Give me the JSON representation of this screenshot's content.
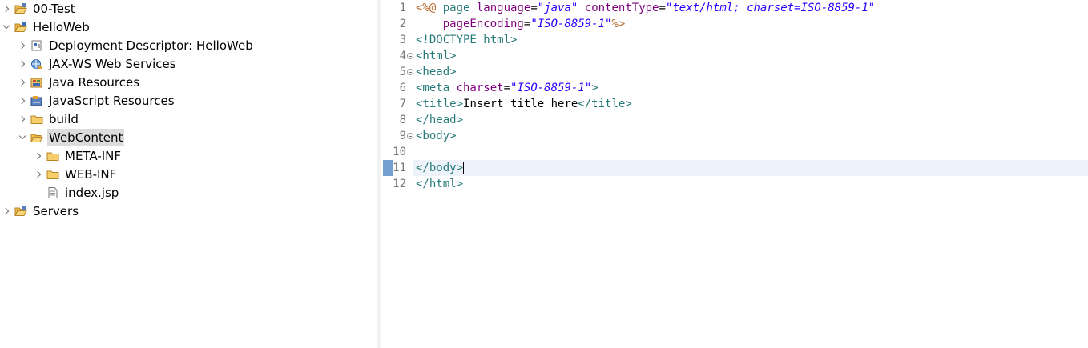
{
  "explorer": {
    "items": [
      {
        "label": "00-Test",
        "icon": "project-folder-icon",
        "expander": "right"
      },
      {
        "label": "HelloWeb",
        "icon": "web-project-icon",
        "expander": "down"
      },
      {
        "label": "Deployment Descriptor: HelloWeb",
        "icon": "deployment-descriptor-icon",
        "expander": "right"
      },
      {
        "label": "JAX-WS Web Services",
        "icon": "web-services-icon",
        "expander": "right"
      },
      {
        "label": "Java Resources",
        "icon": "java-resources-icon",
        "expander": "right"
      },
      {
        "label": "JavaScript Resources",
        "icon": "javascript-resources-icon",
        "expander": "right"
      },
      {
        "label": "build",
        "icon": "folder-icon",
        "expander": "right"
      },
      {
        "label": "WebContent",
        "icon": "open-folder-icon",
        "expander": "down",
        "selected": true
      },
      {
        "label": "META-INF",
        "icon": "folder-icon",
        "expander": "right"
      },
      {
        "label": "WEB-INF",
        "icon": "folder-icon",
        "expander": "right"
      },
      {
        "label": "index.jsp",
        "icon": "jsp-file-icon",
        "expander": "none"
      },
      {
        "label": "Servers",
        "icon": "project-folder-icon",
        "expander": "right"
      }
    ]
  },
  "editor": {
    "line_numbers": [
      "1",
      "2",
      "3",
      "4",
      "5",
      "6",
      "7",
      "8",
      "9",
      "10",
      "11",
      "12"
    ],
    "lines": [
      [
        {
          "t": "<%@",
          "c": "jsp"
        },
        {
          "t": " page ",
          "c": "tag"
        },
        {
          "t": "language",
          "c": "attr"
        },
        {
          "t": "=",
          "c": "plain"
        },
        {
          "t": "\"java\"",
          "c": "val"
        },
        {
          "t": " ",
          "c": "plain"
        },
        {
          "t": "contentType",
          "c": "attr"
        },
        {
          "t": "=",
          "c": "plain"
        },
        {
          "t": "\"text/html; charset=ISO-8859-1\"",
          "c": "val"
        }
      ],
      [
        {
          "t": "    ",
          "c": "plain"
        },
        {
          "t": "pageEncoding",
          "c": "attr"
        },
        {
          "t": "=",
          "c": "plain"
        },
        {
          "t": "\"ISO-8859-1\"",
          "c": "val"
        },
        {
          "t": "%>",
          "c": "jsp"
        }
      ],
      [
        {
          "t": "<!DOCTYPE ",
          "c": "dt"
        },
        {
          "t": "html",
          "c": "kw"
        },
        {
          "t": ">",
          "c": "dt"
        }
      ],
      [
        {
          "t": "<html>",
          "c": "tag"
        }
      ],
      [
        {
          "t": "<head>",
          "c": "tag"
        }
      ],
      [
        {
          "t": "<meta ",
          "c": "tag"
        },
        {
          "t": "charset",
          "c": "attr"
        },
        {
          "t": "=",
          "c": "plain"
        },
        {
          "t": "\"ISO-8859-1\"",
          "c": "val"
        },
        {
          "t": ">",
          "c": "tag"
        }
      ],
      [
        {
          "t": "<title>",
          "c": "tag"
        },
        {
          "t": "Insert title here",
          "c": "plain"
        },
        {
          "t": "</title>",
          "c": "tag"
        }
      ],
      [
        {
          "t": "</head>",
          "c": "tag"
        }
      ],
      [
        {
          "t": "<body>",
          "c": "tag"
        }
      ],
      [],
      [
        {
          "t": "</body>",
          "c": "tag"
        }
      ],
      [
        {
          "t": "</html>",
          "c": "tag"
        }
      ]
    ],
    "fold_lines": [
      4,
      5,
      9
    ],
    "current_line": 11
  },
  "colors": {
    "tag": "#277a7a",
    "attribute": "#7f007f",
    "value": "#2a00ff",
    "jsp_delimiter": "#b86b2f",
    "selection": "#dcdcdc",
    "current_line": "#eef3fb"
  }
}
